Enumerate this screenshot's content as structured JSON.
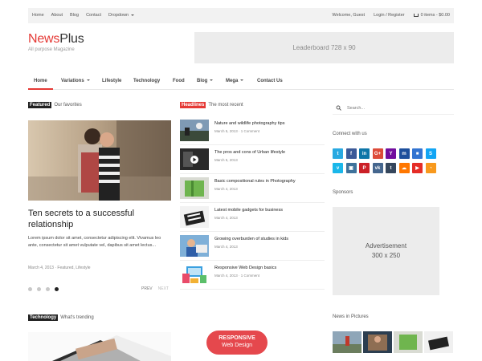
{
  "topbar": {
    "nav": [
      "Home",
      "About",
      "Blog",
      "Contact",
      "Dropdown"
    ],
    "welcome": "Welcome, Guest",
    "login": "Login / Register",
    "cart": "0 items - $0.00"
  },
  "site": {
    "name_part1": "News",
    "name_part2": "Plus",
    "tagline": "All purpose Magazine",
    "leaderboard": "Leaderboard 728 x 90"
  },
  "mainnav": [
    "Home",
    "Variations",
    "Lifestyle",
    "Technology",
    "Food",
    "Blog",
    "Mega",
    "Contact Us"
  ],
  "featured": {
    "tag": "Featured",
    "subtitle": "Our favorites",
    "title": "Ten secrets to a successful relationship",
    "excerpt": "Lorem ipsum dolor sit amet, consectetur adipiscing elit. Vivamus leo ante, consectetur sit amet vulputate vel, dapibus sit amet lectus...",
    "meta": "March 4, 2013 · Featured, Lifestyle",
    "prev": "PREV",
    "next": "NEXT",
    "slides": 4,
    "active_slide": 4
  },
  "headlines": {
    "tag": "Headlines",
    "subtitle": "The most recent",
    "items": [
      {
        "title": "Nature and wildlife photography tips",
        "meta": "March 5, 2013 · 1 Comment"
      },
      {
        "title": "The pros and cons of Urban lifestyle",
        "meta": "March 5, 2013"
      },
      {
        "title": "Basic compositional rules in Photography",
        "meta": "March 4, 2013"
      },
      {
        "title": "Latest mobile gadgets for business",
        "meta": "March 4, 2013"
      },
      {
        "title": "Growing overburden of studies in kids",
        "meta": "March 4, 2013"
      },
      {
        "title": "Responsive Web Design basics",
        "meta": "March 4, 2013 · 1 Comment"
      }
    ]
  },
  "sidebar": {
    "search_placeholder": "Search...",
    "connect_heading": "Connect with us",
    "sponsors_heading": "Sponsors",
    "ad_line1": "Advertisement",
    "ad_line2": "300 x 250",
    "social": [
      {
        "name": "twitter-icon",
        "glyph": "t",
        "color": "#29a9e1"
      },
      {
        "name": "facebook-icon",
        "glyph": "f",
        "color": "#3b5998"
      },
      {
        "name": "linkedin-icon",
        "glyph": "in",
        "color": "#0e76a8"
      },
      {
        "name": "googleplus-icon",
        "glyph": "G+",
        "color": "#dd4b39"
      },
      {
        "name": "yahoo-icon",
        "glyph": "Y",
        "color": "#720e9e"
      },
      {
        "name": "myspace-icon",
        "glyph": "m",
        "color": "#1d4f9c"
      },
      {
        "name": "delicious-icon",
        "glyph": "■",
        "color": "#3274d1"
      },
      {
        "name": "skype-icon",
        "glyph": "S",
        "color": "#12a5f4"
      },
      {
        "name": "vimeo-icon",
        "glyph": "v",
        "color": "#1ab7ea"
      },
      {
        "name": "instagram-icon",
        "glyph": "▣",
        "color": "#3f729b"
      },
      {
        "name": "pinterest-icon",
        "glyph": "P",
        "color": "#cb2027"
      },
      {
        "name": "vk-icon",
        "glyph": "vk",
        "color": "#45668e"
      },
      {
        "name": "tumblr-icon",
        "glyph": "t",
        "color": "#35465c"
      },
      {
        "name": "soundcloud-icon",
        "glyph": "☁",
        "color": "#ff7700"
      },
      {
        "name": "youtube-icon",
        "glyph": "▶",
        "color": "#e52d27"
      },
      {
        "name": "rss-icon",
        "glyph": "◔",
        "color": "#f8991d"
      }
    ]
  },
  "trending": {
    "tag": "Technology",
    "subtitle": "What's trending",
    "badge_line1": "RESPONSIVE",
    "badge_line2": "Web Design"
  },
  "news_in_pictures": {
    "heading": "News in Pictures"
  },
  "colors": {
    "accent": "#e53935",
    "tag_dark": "#222222"
  }
}
